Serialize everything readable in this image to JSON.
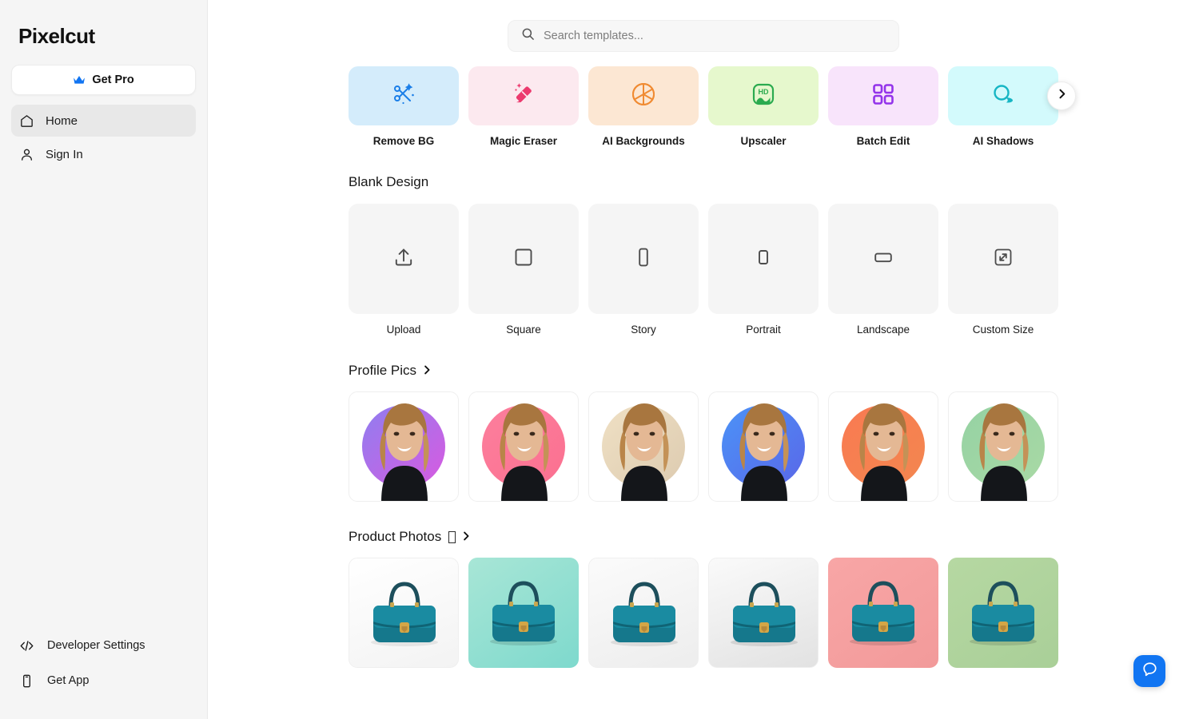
{
  "app": {
    "brand": "Pixelcut"
  },
  "sidebar": {
    "get_pro_label": "Get Pro",
    "get_pro_icon": "crown-icon",
    "nav": [
      {
        "label": "Home",
        "icon": "home-icon",
        "active": true
      },
      {
        "label": "Sign In",
        "icon": "user-icon",
        "active": false
      }
    ],
    "bottom": [
      {
        "label": "Developer Settings",
        "icon": "code-icon"
      },
      {
        "label": "Get App",
        "icon": "phone-icon"
      }
    ]
  },
  "search": {
    "placeholder": "Search templates...",
    "value": "",
    "icon": "search-icon"
  },
  "tools": {
    "next_icon": "chevron-right-icon",
    "items": [
      {
        "label": "Remove BG",
        "icon": "scissors-sparkle-icon",
        "bg": "#d4ecfb",
        "fg": "#1a7ee8",
        "selected": true
      },
      {
        "label": "Magic Eraser",
        "icon": "eraser-sparkle-icon",
        "bg": "#fce9ef",
        "fg": "#ec3a6e",
        "selected": false
      },
      {
        "label": "AI Backgrounds",
        "icon": "aperture-icon",
        "bg": "#fce7d3",
        "fg": "#f08b32",
        "selected": false
      },
      {
        "label": "Upscaler",
        "icon": "hd-icon",
        "bg": "#e6f8cd",
        "fg": "#2bab4f",
        "selected": false
      },
      {
        "label": "Batch Edit",
        "icon": "grid-four-icon",
        "bg": "#f8e4fb",
        "fg": "#9333ea",
        "selected": false
      },
      {
        "label": "AI Shadows",
        "icon": "shadow-circle-icon",
        "bg": "#d3fafc",
        "fg": "#17b6c4",
        "selected": false
      }
    ]
  },
  "blank_design": {
    "title": "Blank Design",
    "items": [
      {
        "label": "Upload",
        "icon": "upload-icon"
      },
      {
        "label": "Square",
        "icon": "square-icon"
      },
      {
        "label": "Story",
        "icon": "story-rect-icon"
      },
      {
        "label": "Portrait",
        "icon": "portrait-rect-icon"
      },
      {
        "label": "Landscape",
        "icon": "landscape-rect-icon"
      },
      {
        "label": "Custom Size",
        "icon": "expand-arrows-icon"
      }
    ]
  },
  "profile_pics": {
    "title": "Profile Pics",
    "chevron_icon": "chevron-right-icon",
    "items": [
      {
        "name": "profile-purple-magenta",
        "bg_from": "#8f7ef0",
        "bg_to": "#d95ae0"
      },
      {
        "name": "profile-pink",
        "bg_from": "#fc7f9d",
        "bg_to": "#fb7090"
      },
      {
        "name": "profile-cream",
        "bg_from": "#efe0c4",
        "bg_to": "#ddcbb0"
      },
      {
        "name": "profile-blue",
        "bg_from": "#4b93f7",
        "bg_to": "#5a67e8"
      },
      {
        "name": "profile-orange",
        "bg_from": "#f97a52",
        "bg_to": "#f3874f"
      },
      {
        "name": "profile-green",
        "bg_from": "#95d2a3",
        "bg_to": "#a9d9a5"
      }
    ]
  },
  "product_photos": {
    "title": "Product Photos",
    "has_missing_glyph": true,
    "chevron_icon": "chevron-right-icon",
    "items": [
      {
        "name": "bag-white",
        "bg_from": "#ffffff",
        "bg_to": "#f3f3f3",
        "bordered": true
      },
      {
        "name": "bag-teal",
        "bg_from": "#a8e6d6",
        "bg_to": "#7ed9cd",
        "bordered": false
      },
      {
        "name": "bag-soft-white",
        "bg_from": "#fbfbfb",
        "bg_to": "#ededed",
        "bordered": true
      },
      {
        "name": "bag-gray",
        "bg_from": "#fafafa",
        "bg_to": "#e2e2e2",
        "bordered": true
      },
      {
        "name": "bag-pink",
        "bg_from": "#f8a6a6",
        "bg_to": "#f29a9a",
        "bordered": false
      },
      {
        "name": "bag-green",
        "bg_from": "#b6d8a2",
        "bg_to": "#a9cf98",
        "bordered": false
      }
    ]
  },
  "chat": {
    "icon": "chat-bubble-icon",
    "color": "#1175f2"
  },
  "colors": {
    "sidebar_bg": "#f5f5f5",
    "main_bg": "#ffffff",
    "accent": "#1175f2",
    "tile_bg": "#f5f5f5"
  }
}
